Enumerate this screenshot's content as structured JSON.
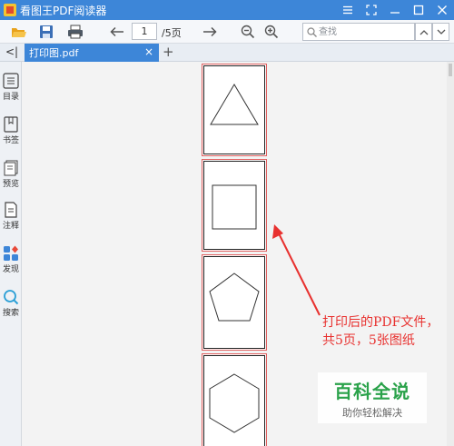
{
  "window": {
    "title": "看图王PDF阅读器",
    "controls": [
      "menu-icon",
      "fullscreen-icon",
      "minimize-icon",
      "maximize-icon",
      "close-icon"
    ]
  },
  "toolbar": {
    "icons": [
      "open-folder-icon",
      "save-icon",
      "print-icon",
      "prev-page-icon",
      "next-page-icon",
      "zoom-out-icon",
      "zoom-in-icon"
    ],
    "current_page": "1",
    "total_pages": "/5页",
    "search_placeholder": "查找"
  },
  "tabs": {
    "collapse_label": "<|",
    "active_tab": "打印图.pdf",
    "close_symbol": "×",
    "new_tab_symbol": "+"
  },
  "sidebar": {
    "items": [
      {
        "icon": "list-icon",
        "label": "目录"
      },
      {
        "icon": "bookmark-icon",
        "label": "书签"
      },
      {
        "icon": "thumbnails-icon",
        "label": "预览"
      },
      {
        "icon": "annotation-icon",
        "label": "注释"
      },
      {
        "icon": "discover-icon",
        "label": "发现"
      },
      {
        "icon": "search-icon",
        "label": "搜索"
      }
    ]
  },
  "document": {
    "pages": [
      {
        "shape": "triangle"
      },
      {
        "shape": "square"
      },
      {
        "shape": "pentagon"
      },
      {
        "shape": "hexagon"
      }
    ]
  },
  "annotation": {
    "text": "打印后的PDF文件，共5页，5张图纸",
    "color": "#e8312f"
  },
  "watermark": {
    "main": "百科全说",
    "sub": "助你轻松解决"
  },
  "colors": {
    "titlebar": "#3d86d8",
    "accent": "#3d86d8",
    "page_border": "#e06060",
    "watermark_green": "#2aa24a"
  }
}
